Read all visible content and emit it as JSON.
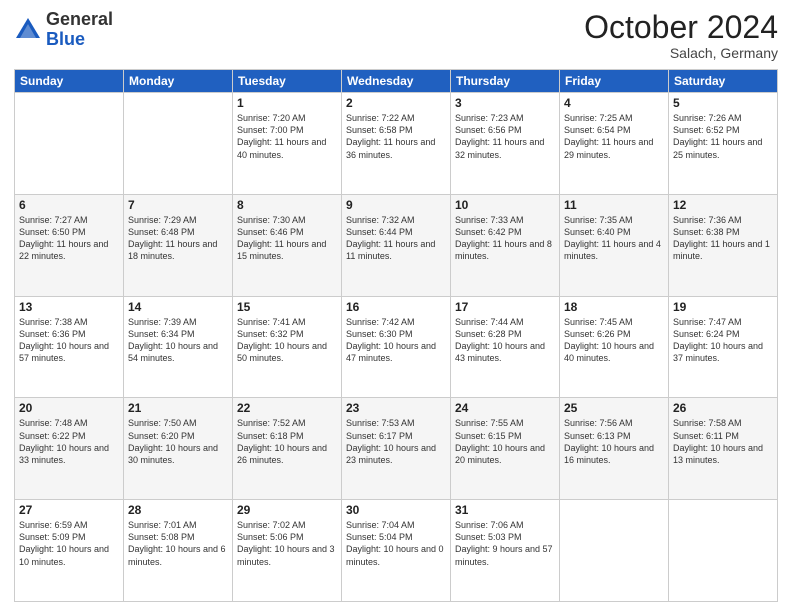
{
  "header": {
    "logo_general": "General",
    "logo_blue": "Blue",
    "month_title": "October 2024",
    "subtitle": "Salach, Germany"
  },
  "days_of_week": [
    "Sunday",
    "Monday",
    "Tuesday",
    "Wednesday",
    "Thursday",
    "Friday",
    "Saturday"
  ],
  "weeks": [
    [
      {
        "day": "",
        "info": ""
      },
      {
        "day": "",
        "info": ""
      },
      {
        "day": "1",
        "info": "Sunrise: 7:20 AM\nSunset: 7:00 PM\nDaylight: 11 hours and 40 minutes."
      },
      {
        "day": "2",
        "info": "Sunrise: 7:22 AM\nSunset: 6:58 PM\nDaylight: 11 hours and 36 minutes."
      },
      {
        "day": "3",
        "info": "Sunrise: 7:23 AM\nSunset: 6:56 PM\nDaylight: 11 hours and 32 minutes."
      },
      {
        "day": "4",
        "info": "Sunrise: 7:25 AM\nSunset: 6:54 PM\nDaylight: 11 hours and 29 minutes."
      },
      {
        "day": "5",
        "info": "Sunrise: 7:26 AM\nSunset: 6:52 PM\nDaylight: 11 hours and 25 minutes."
      }
    ],
    [
      {
        "day": "6",
        "info": "Sunrise: 7:27 AM\nSunset: 6:50 PM\nDaylight: 11 hours and 22 minutes."
      },
      {
        "day": "7",
        "info": "Sunrise: 7:29 AM\nSunset: 6:48 PM\nDaylight: 11 hours and 18 minutes."
      },
      {
        "day": "8",
        "info": "Sunrise: 7:30 AM\nSunset: 6:46 PM\nDaylight: 11 hours and 15 minutes."
      },
      {
        "day": "9",
        "info": "Sunrise: 7:32 AM\nSunset: 6:44 PM\nDaylight: 11 hours and 11 minutes."
      },
      {
        "day": "10",
        "info": "Sunrise: 7:33 AM\nSunset: 6:42 PM\nDaylight: 11 hours and 8 minutes."
      },
      {
        "day": "11",
        "info": "Sunrise: 7:35 AM\nSunset: 6:40 PM\nDaylight: 11 hours and 4 minutes."
      },
      {
        "day": "12",
        "info": "Sunrise: 7:36 AM\nSunset: 6:38 PM\nDaylight: 11 hours and 1 minute."
      }
    ],
    [
      {
        "day": "13",
        "info": "Sunrise: 7:38 AM\nSunset: 6:36 PM\nDaylight: 10 hours and 57 minutes."
      },
      {
        "day": "14",
        "info": "Sunrise: 7:39 AM\nSunset: 6:34 PM\nDaylight: 10 hours and 54 minutes."
      },
      {
        "day": "15",
        "info": "Sunrise: 7:41 AM\nSunset: 6:32 PM\nDaylight: 10 hours and 50 minutes."
      },
      {
        "day": "16",
        "info": "Sunrise: 7:42 AM\nSunset: 6:30 PM\nDaylight: 10 hours and 47 minutes."
      },
      {
        "day": "17",
        "info": "Sunrise: 7:44 AM\nSunset: 6:28 PM\nDaylight: 10 hours and 43 minutes."
      },
      {
        "day": "18",
        "info": "Sunrise: 7:45 AM\nSunset: 6:26 PM\nDaylight: 10 hours and 40 minutes."
      },
      {
        "day": "19",
        "info": "Sunrise: 7:47 AM\nSunset: 6:24 PM\nDaylight: 10 hours and 37 minutes."
      }
    ],
    [
      {
        "day": "20",
        "info": "Sunrise: 7:48 AM\nSunset: 6:22 PM\nDaylight: 10 hours and 33 minutes."
      },
      {
        "day": "21",
        "info": "Sunrise: 7:50 AM\nSunset: 6:20 PM\nDaylight: 10 hours and 30 minutes."
      },
      {
        "day": "22",
        "info": "Sunrise: 7:52 AM\nSunset: 6:18 PM\nDaylight: 10 hours and 26 minutes."
      },
      {
        "day": "23",
        "info": "Sunrise: 7:53 AM\nSunset: 6:17 PM\nDaylight: 10 hours and 23 minutes."
      },
      {
        "day": "24",
        "info": "Sunrise: 7:55 AM\nSunset: 6:15 PM\nDaylight: 10 hours and 20 minutes."
      },
      {
        "day": "25",
        "info": "Sunrise: 7:56 AM\nSunset: 6:13 PM\nDaylight: 10 hours and 16 minutes."
      },
      {
        "day": "26",
        "info": "Sunrise: 7:58 AM\nSunset: 6:11 PM\nDaylight: 10 hours and 13 minutes."
      }
    ],
    [
      {
        "day": "27",
        "info": "Sunrise: 6:59 AM\nSunset: 5:09 PM\nDaylight: 10 hours and 10 minutes."
      },
      {
        "day": "28",
        "info": "Sunrise: 7:01 AM\nSunset: 5:08 PM\nDaylight: 10 hours and 6 minutes."
      },
      {
        "day": "29",
        "info": "Sunrise: 7:02 AM\nSunset: 5:06 PM\nDaylight: 10 hours and 3 minutes."
      },
      {
        "day": "30",
        "info": "Sunrise: 7:04 AM\nSunset: 5:04 PM\nDaylight: 10 hours and 0 minutes."
      },
      {
        "day": "31",
        "info": "Sunrise: 7:06 AM\nSunset: 5:03 PM\nDaylight: 9 hours and 57 minutes."
      },
      {
        "day": "",
        "info": ""
      },
      {
        "day": "",
        "info": ""
      }
    ]
  ]
}
